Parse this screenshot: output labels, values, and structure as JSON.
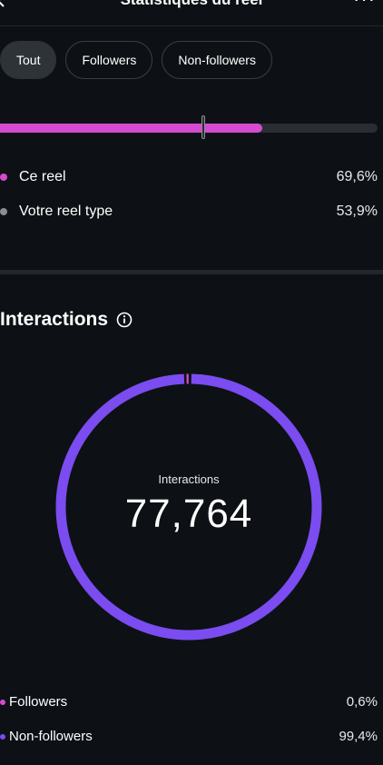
{
  "header": {
    "title": "Statistiques du reel",
    "more_icon": "more-horizontal-icon",
    "back_icon": "chevron-left-icon"
  },
  "tabs": [
    {
      "label": "Tout",
      "active": true
    },
    {
      "label": "Followers",
      "active": false
    },
    {
      "label": "Non-followers",
      "active": false
    }
  ],
  "comparison": {
    "bar_fill_fraction": 0.696,
    "marker_fraction": 0.539,
    "colors": {
      "this_reel": "#d54bd0",
      "typical": "#8a8f95"
    },
    "rows": [
      {
        "label": "Ce reel",
        "value": "69,6%"
      },
      {
        "label": "Votre reel type",
        "value": "53,9%"
      }
    ]
  },
  "interactions": {
    "title": "Interactions",
    "info_icon": "info-icon",
    "ring_label": "Interactions",
    "total": "77,764",
    "colors": {
      "followers": "#d54bd0",
      "non_followers": "#7b4cf0"
    },
    "segments": [
      {
        "label": "Followers",
        "value": "0,6%",
        "fraction": 0.006
      },
      {
        "label": "Non-followers",
        "value": "99,4%",
        "fraction": 0.994
      }
    ]
  }
}
